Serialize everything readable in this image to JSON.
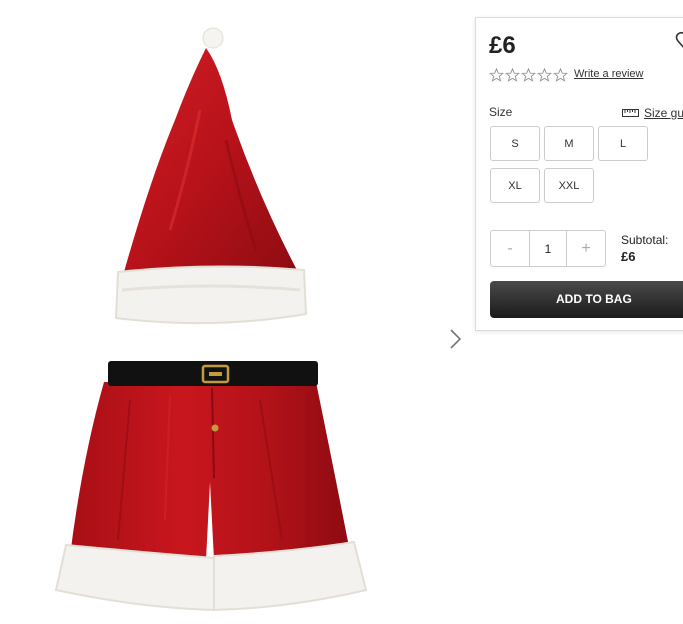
{
  "product": {
    "price": "£6",
    "rating_stars": 0,
    "write_review_label": "Write a review"
  },
  "size_section": {
    "label": "Size",
    "guide_label": "Size gu",
    "options": [
      "S",
      "M",
      "L",
      "XL",
      "XXL"
    ]
  },
  "quantity": {
    "minus": "-",
    "value": "1",
    "plus": "+"
  },
  "subtotal": {
    "label": "Subtotal:",
    "value": "£6"
  },
  "add_to_bag_label": "ADD TO BAG",
  "colors": {
    "velvet_red": "#b5161d",
    "fur_white": "#f4f2ee",
    "button_dark": "#2a2a2a"
  },
  "icons": [
    "chevron-right-icon",
    "heart-icon",
    "star-icon",
    "ruler-icon"
  ]
}
